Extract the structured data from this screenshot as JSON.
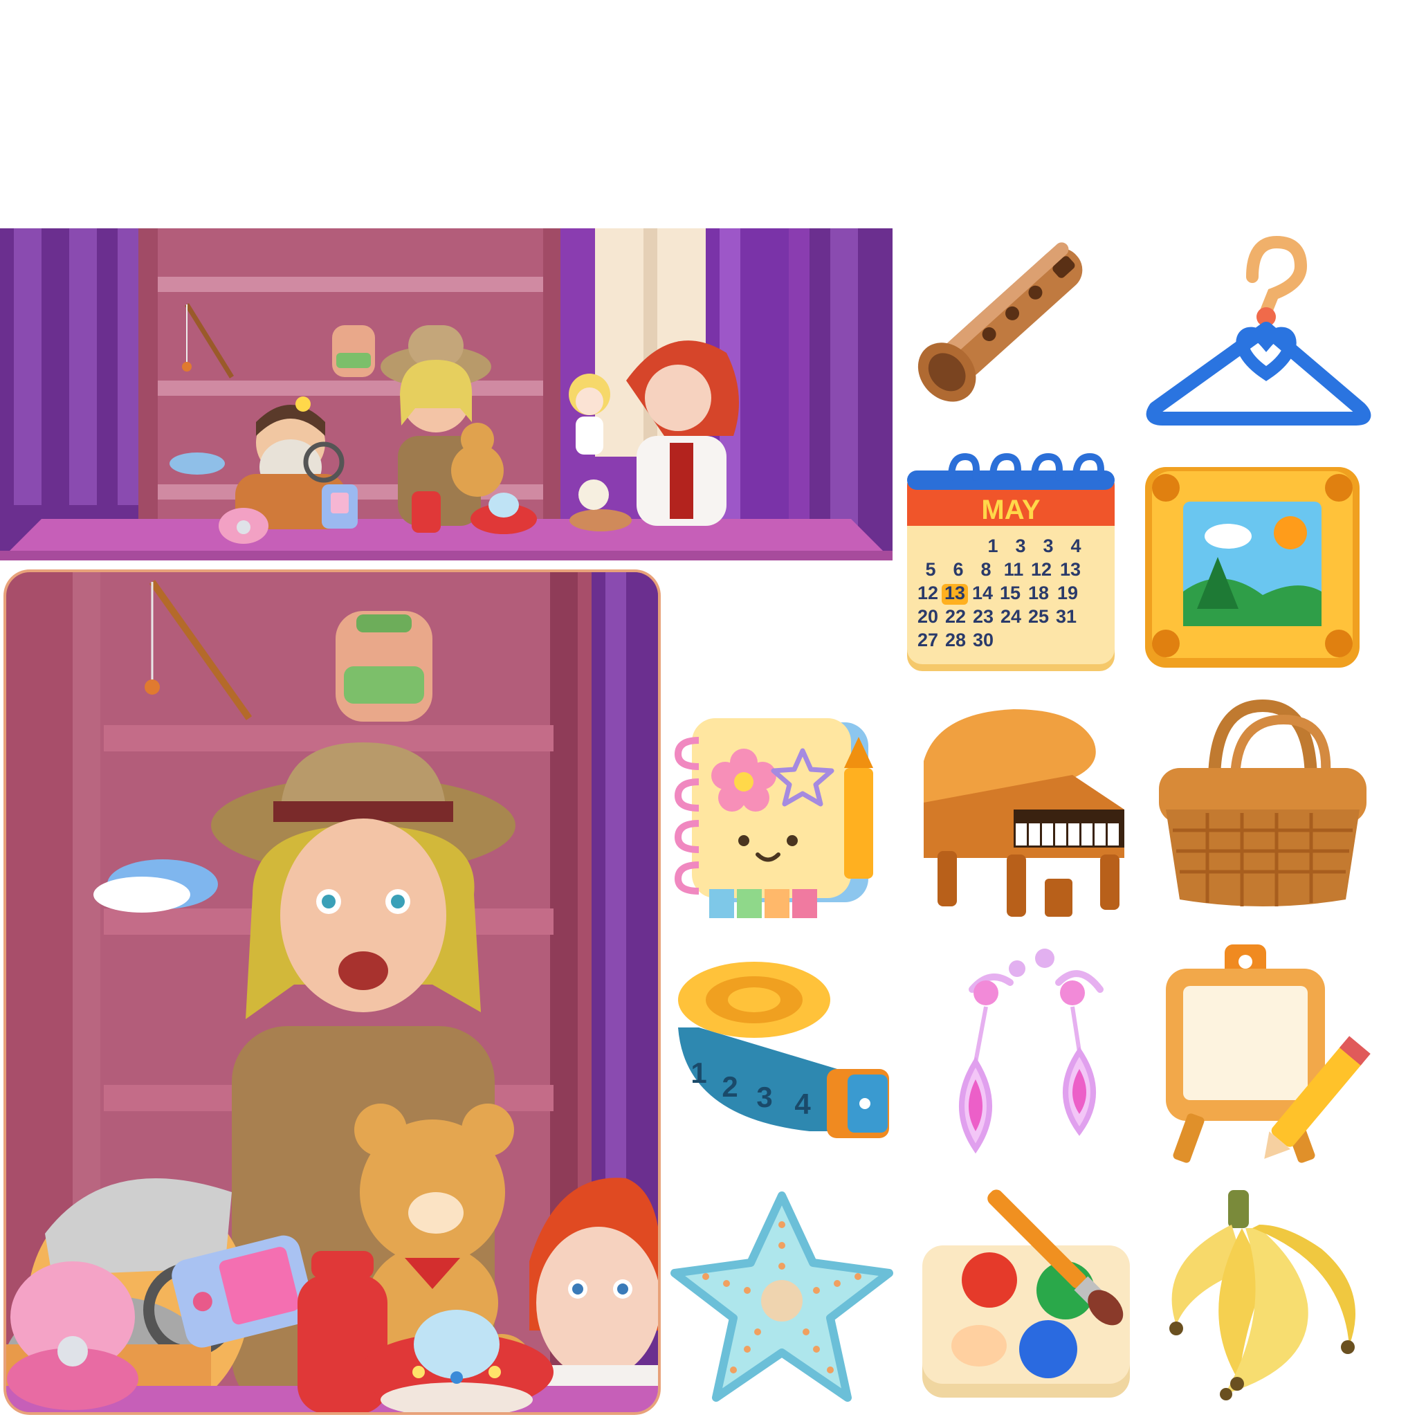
{
  "scenes": [
    {
      "name": "wide-shelf-scene"
    },
    {
      "name": "tall-shelf-scene"
    }
  ],
  "items": [
    {
      "name": "recorder-flute",
      "icon": "recorder-icon"
    },
    {
      "name": "clothes-hanger",
      "icon": "hanger-icon"
    },
    {
      "name": "calendar",
      "icon": "calendar-icon",
      "month": "MAY",
      "days": [
        "1",
        "3",
        "3",
        "4",
        "5",
        "6",
        "8",
        "11",
        "12",
        "13",
        "12",
        "13",
        "14",
        "15",
        "18",
        "19",
        "20",
        "22",
        "23",
        "24",
        "25",
        "31",
        "27",
        "28",
        "30"
      ],
      "highlight": "13"
    },
    {
      "name": "picture-frame",
      "icon": "picture-frame-icon"
    },
    {
      "name": "sketchbook",
      "icon": "sketchbook-icon"
    },
    {
      "name": "grand-piano",
      "icon": "grand-piano-icon"
    },
    {
      "name": "picnic-basket",
      "icon": "basket-icon"
    },
    {
      "name": "measuring-tape",
      "icon": "measuring-tape-icon",
      "marks": [
        "1",
        "2",
        "3",
        "4"
      ]
    },
    {
      "name": "earrings",
      "icon": "earrings-icon"
    },
    {
      "name": "easel",
      "icon": "easel-icon"
    },
    {
      "name": "starfish",
      "icon": "starfish-icon"
    },
    {
      "name": "paint-palette",
      "icon": "paint-palette-icon"
    },
    {
      "name": "bananas",
      "icon": "bananas-icon"
    }
  ],
  "colors": {
    "curtain": "#7a3aa0",
    "shelf": "#b8607a",
    "counter": "#c86ab8",
    "frame_border": "#e8a27a"
  }
}
